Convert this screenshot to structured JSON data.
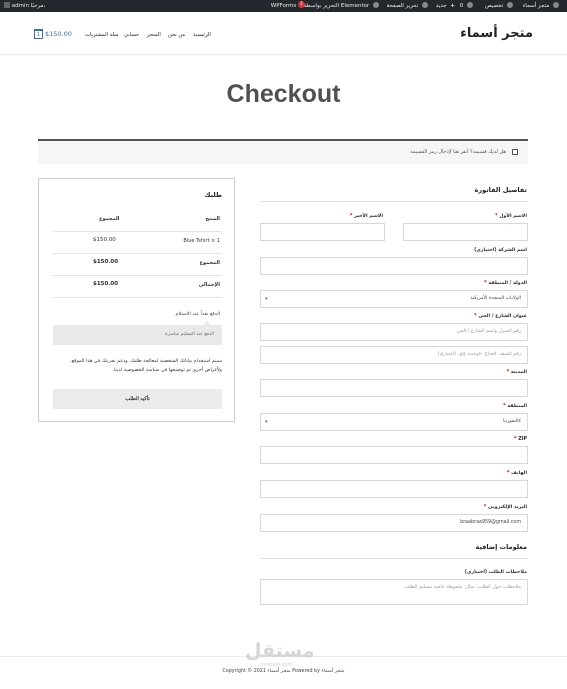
{
  "admin_bar": {
    "site_name": "متجر أسماء",
    "customize": "تخصيص",
    "comments_count": "0",
    "new_label": "جديد",
    "edit_page": "تحرير الصفحة",
    "edit_elementor": "التحرير بواسطة Elementor",
    "wpforms": "WPForms",
    "wpforms_count": "1",
    "greeting": "مرحبًا،",
    "user": "admin"
  },
  "header": {
    "site_title": "متجر أسماء",
    "nav": [
      "الرئيسية",
      "من نحن",
      "المتجر",
      "حسابي",
      "سلة المشتريات"
    ],
    "cart_count": "1",
    "cart_total": "$150.00"
  },
  "page_title": "Checkout",
  "coupon_notice": "هل لديك قسيمة؟ أنقر هنا لإدخال رمز القسيمة",
  "billing": {
    "heading": "تفاصيل الفاتورة",
    "first_name_label": "الاسم الأول",
    "last_name_label": "الاسم الأخير",
    "company_label": "اسم الشركة (اختياري)",
    "country_label": "الدولة / المنطقة",
    "country_value": "الولايات المتحدة الأمريكية",
    "street_label": "عنوان الشارع / الحي",
    "street_placeholder": "رقم المنزل واسم الشارع / الحي",
    "apartment_placeholder": "رقم الشقة، الجناح، الوحدة، إلخ. (اختياري)",
    "city_label": "المدينة",
    "state_label": "المنطقة",
    "state_value": "كاليفورنيا",
    "zip_label": "ZIP",
    "phone_label": "الهاتف",
    "email_label": "البريد الإلكتروني",
    "email_value": "braabraa959@gmail.com",
    "required_mark": "*"
  },
  "additional": {
    "heading": "معلومات إضافية",
    "notes_label": "ملاحظات الطلب (اختياري)",
    "notes_placeholder": "ملاحظات حول الطلب، مثال: ملحوظة خاصة بتسليم الطلب."
  },
  "order": {
    "heading": "طلبك",
    "col_product": "المنتج",
    "col_total": "المجموع",
    "item_name": "Blue Tshirt",
    "item_qty": "× 1",
    "item_total": "$150.00",
    "subtotal_label": "المجموع",
    "subtotal_value": "$150.00",
    "total_label": "الإجمالي",
    "total_value": "$150.00",
    "payment_method": "الدفع نقداً عند الاستلام",
    "payment_desc": "الدفع عند التسليم مباشرة.",
    "privacy_text": "سيتم استخدام بياناتك الشخصية لمعالجة طلبك، ودعم تجربتك في هذا الموقع، ولأغراض أخرى تم توضيحها في سياسة الخصوصية لدينا.",
    "place_order": "تأكيد الطلب"
  },
  "footer": {
    "text": "Copyright © 2021 متجر أسماء Powered by متجر أسماء"
  },
  "watermark": {
    "text": "مستقل",
    "sub": "mostaql.com"
  }
}
